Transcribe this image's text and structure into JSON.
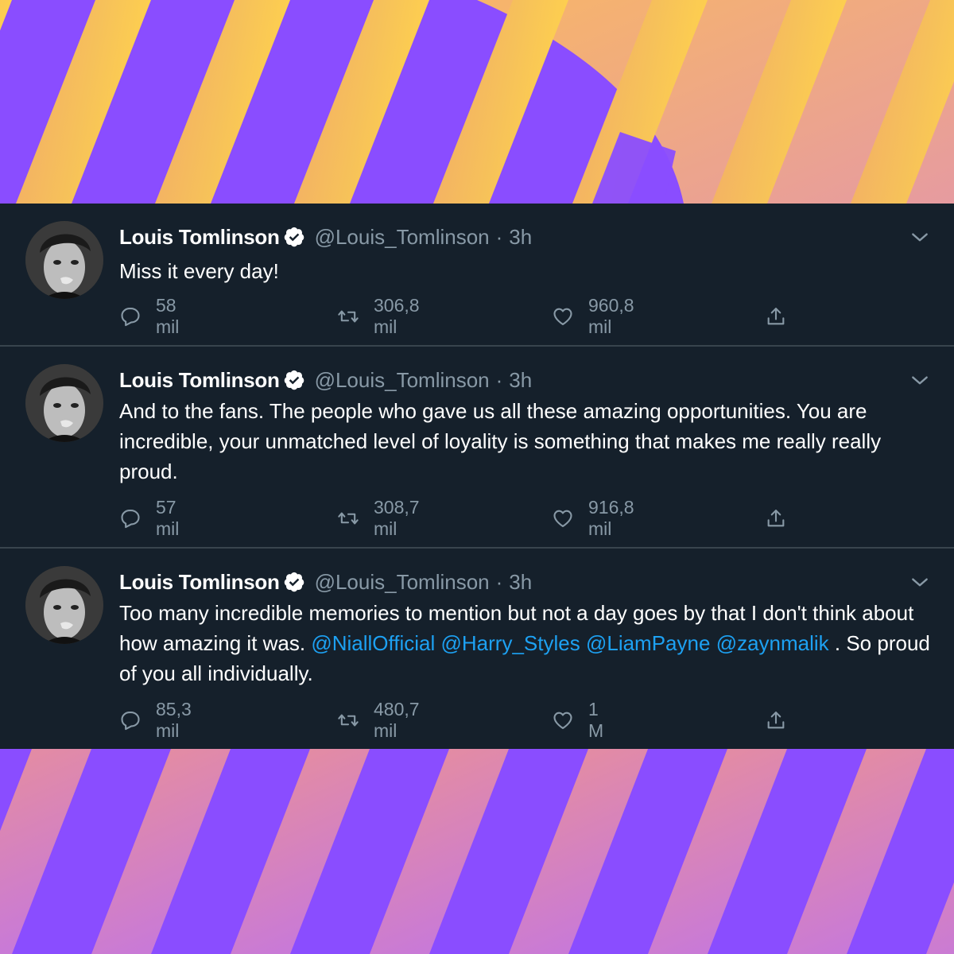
{
  "colors": {
    "panel_bg": "#15202b",
    "text": "#ffffff",
    "muted": "#8899a6",
    "link": "#1da1f2",
    "verified_badge": "#ffffff",
    "stripe_purple": "#8a4dff",
    "stripe_yellow": "#ffd24d",
    "stripe_pink": "#e0809a"
  },
  "tweets": [
    {
      "name": "Louis Tomlinson",
      "handle": "@Louis_Tomlinson",
      "separator": "·",
      "time": "3h",
      "text_parts": [
        "Miss it every day!"
      ],
      "replies": "58 mil",
      "retweets": "306,8 mil",
      "likes": "960,8 mil",
      "icons": {
        "reply": "reply-icon",
        "retweet": "retweet-icon",
        "like": "heart-icon",
        "share": "share-icon",
        "menu": "chevron-down-icon",
        "verified": "verified-badge-icon"
      }
    },
    {
      "name": "Louis Tomlinson",
      "handle": "@Louis_Tomlinson",
      "separator": "·",
      "time": "3h",
      "text_parts": [
        "And to the fans. The people who gave us all these amazing opportunities. You are incredible, your unmatched level of loyality is something that makes me really really proud."
      ],
      "replies": "57 mil",
      "retweets": "308,7 mil",
      "likes": "916,8 mil"
    },
    {
      "name": "Louis Tomlinson",
      "handle": "@Louis_Tomlinson",
      "separator": "·",
      "time": "3h",
      "text_parts": [
        "Too many incredible memories to mention but not a day goes by that I don't think about how amazing it was. ",
        "@NiallOfficial",
        " ",
        "@Harry_Styles",
        " ",
        "@LiamPayne",
        " ",
        "@zaynmalik",
        " . So proud of you all individually."
      ],
      "replies": "85,3 mil",
      "retweets": "480,7 mil",
      "likes": "1 M"
    }
  ]
}
